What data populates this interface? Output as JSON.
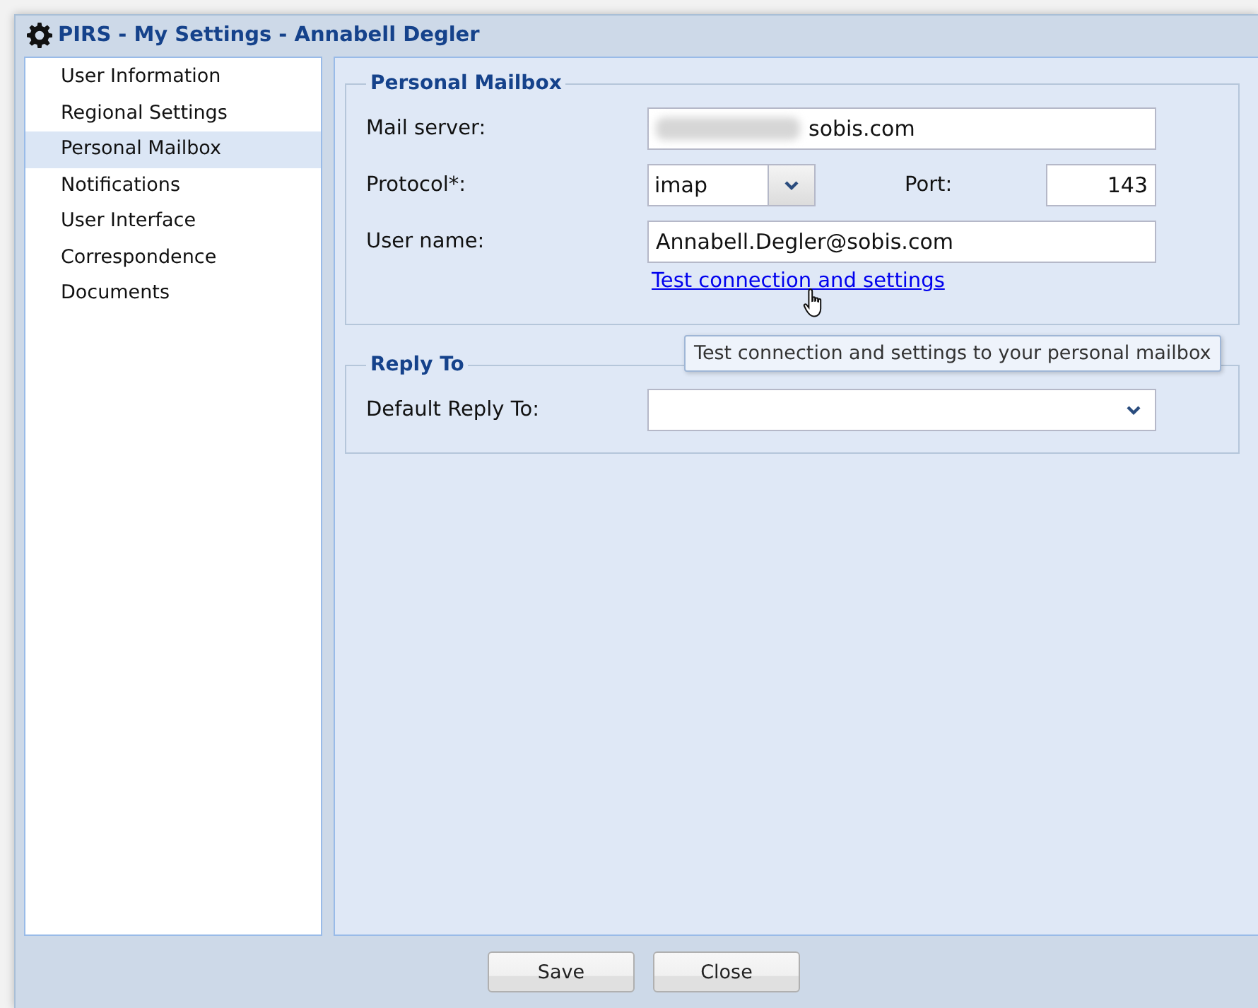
{
  "window": {
    "title": "PIRS - My Settings - Annabell Degler"
  },
  "sidebar": {
    "items": [
      {
        "label": "User Information",
        "selected": false
      },
      {
        "label": "Regional Settings",
        "selected": false
      },
      {
        "label": "Personal Mailbox",
        "selected": true
      },
      {
        "label": "Notifications",
        "selected": false
      },
      {
        "label": "User Interface",
        "selected": false
      },
      {
        "label": "Correspondence",
        "selected": false
      },
      {
        "label": "Documents",
        "selected": false
      }
    ]
  },
  "sections": [
    {
      "title": "Personal Mailbox",
      "rows": [
        {
          "kind": "text",
          "label": "Mail server:",
          "value": "sobis.com",
          "redacted": true
        },
        {
          "kind": "select",
          "label": "Protocol*:",
          "value": "imap",
          "port_label": "Port:",
          "port_value": "143"
        },
        {
          "kind": "text",
          "label": "User name:",
          "value": "Annabell.Degler@sobis.com",
          "redacted": false
        },
        {
          "kind": "link",
          "text": "Test connection and settings"
        }
      ]
    },
    {
      "title": "Reply To",
      "rows": [
        {
          "kind": "combo",
          "label": "Default Reply To:"
        }
      ]
    }
  ],
  "tooltip": {
    "text": "Test connection and settings to your personal mailbox"
  },
  "buttons": [
    "Save",
    "Close"
  ]
}
